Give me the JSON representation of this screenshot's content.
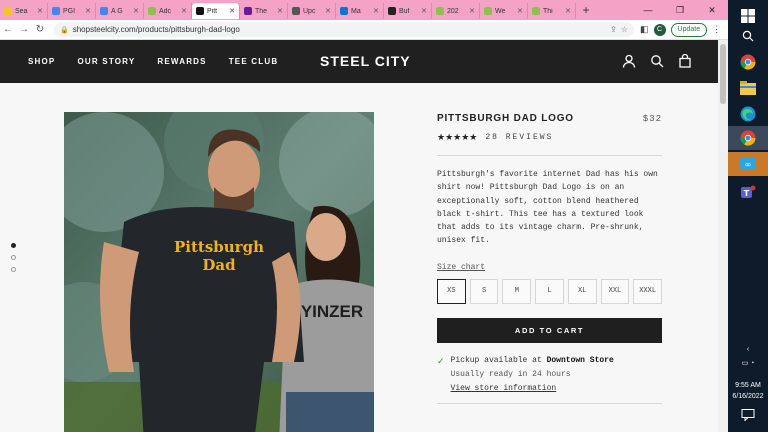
{
  "browser": {
    "tabs": [
      {
        "label": "Sea",
        "color": "#f5c518"
      },
      {
        "label": "PGI",
        "color": "#4285f4"
      },
      {
        "label": "A G",
        "color": "#4285f4"
      },
      {
        "label": "Adc",
        "color": "#8bc34a"
      },
      {
        "label": "Pitt",
        "color": "#111111"
      },
      {
        "label": "The",
        "color": "#6a1b9a"
      },
      {
        "label": "Upc",
        "color": "#555555"
      },
      {
        "label": "Ma",
        "color": "#0078d4"
      },
      {
        "label": "Buf",
        "color": "#222222"
      },
      {
        "label": "202",
        "color": "#8bc34a"
      },
      {
        "label": "We",
        "color": "#8bc34a"
      },
      {
        "label": "Thi",
        "color": "#8bc34a"
      }
    ],
    "active_tab": 4,
    "new_tab": "+",
    "url": "shopsteelcity.com/products/pittsburgh-dad-logo",
    "avatar_letter": "C",
    "update_label": "Update",
    "win_min": "—",
    "win_max": "❐",
    "win_close": "✕"
  },
  "header": {
    "nav": [
      "SHOP",
      "OUR STORY",
      "REWARDS",
      "TEE CLUB"
    ],
    "brand": "STEEL CITY"
  },
  "product": {
    "title": "PITTSBURGH DAD LOGO",
    "price": "$32",
    "stars": "★★★★★",
    "reviews": "28 REVIEWS",
    "description": "Pittsburgh's favorite internet Dad has his own shirt now! Pittsburgh Dad Logo is on an exceptionally soft, cotton blend heathered black t-shirt. This tee has a textured look that adds to its vintage charm. Pre-shrunk, unisex fit.",
    "size_chart_label": "Size chart",
    "sizes": [
      "XS",
      "S",
      "M",
      "L",
      "XL",
      "XXL",
      "XXXL"
    ],
    "selected_size": "XS",
    "add_to_cart": "ADD TO CART",
    "pickup_prefix": "Pickup available at ",
    "pickup_store": "Downtown Store",
    "pickup_ready": "Usually ready in 24 hours",
    "store_info_link": "View store information",
    "shirt_text_line1": "Pittsburgh",
    "shirt_text_line2": "Dad",
    "shirt2_text": "YINZER"
  },
  "carousel": {
    "count": 3,
    "active": 0
  },
  "taskbar": {
    "time": "9:55 AM",
    "date": "6/16/2022"
  },
  "colors": {
    "header_bg": "#202020",
    "tabstrip_bg": "#f4a3c6",
    "check_green": "#2e8b3d",
    "taskbar_bg": "#0d1b2a"
  }
}
